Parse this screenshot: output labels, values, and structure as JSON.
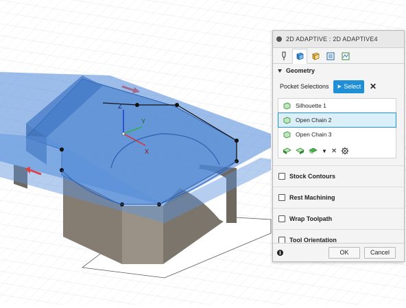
{
  "panel": {
    "title": "2D ADAPTIVE : 2D ADAPTIVE4",
    "tabs": [
      "tool-tab-icon",
      "geometry-tab-icon",
      "heights-tab-icon",
      "passes-tab-icon",
      "linking-tab-icon"
    ],
    "active_tab": 1,
    "geometry": {
      "header": "Geometry",
      "pocket_label": "Pocket Selections",
      "select_label": "Select",
      "items": [
        "Silhouette 1",
        "Open Chain 2",
        "Open Chain 3"
      ],
      "selected_index": 1
    },
    "sections": [
      "Stock Contours",
      "Rest Machining",
      "Wrap Toolpath",
      "Tool Orientation"
    ],
    "ok_label": "OK",
    "cancel_label": "Cancel"
  },
  "viewport": {
    "axis_labels": {
      "z": "Z",
      "y": "Y",
      "x": "X"
    },
    "colors": {
      "plane": "#4a86d8",
      "grid": "#cfd4da",
      "part": "#8a8378",
      "chain": "#1a1a1a"
    }
  }
}
